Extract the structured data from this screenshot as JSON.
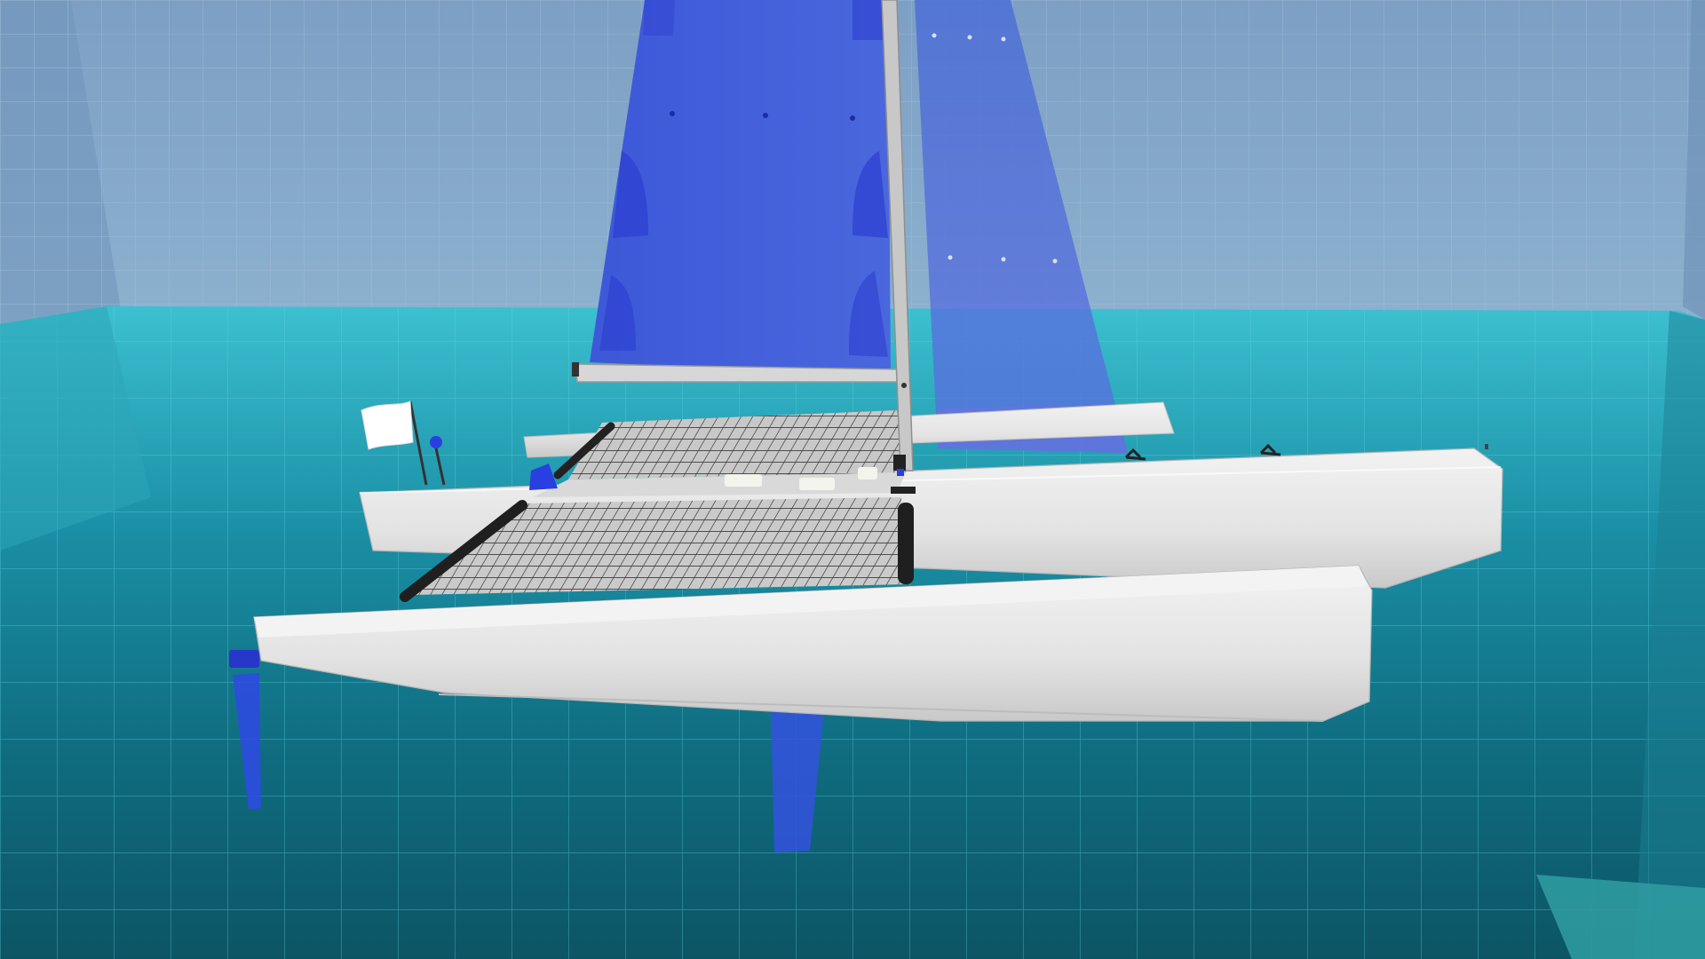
{
  "scene": {
    "kind": "3d-viewport",
    "subject": "catamaran-sailboat",
    "colors": {
      "room_wall": "#7a9ec2",
      "water_near": "#0d5a6a",
      "water_far": "#37b9cb",
      "hull": "#e7e7e7",
      "sail": "#3f5ae0",
      "foil": "#2b45e6",
      "flag": "#ffffff"
    },
    "objects": [
      {
        "name": "mainsail",
        "icon": "sail-icon"
      },
      {
        "name": "jib",
        "icon": "sail-icon"
      },
      {
        "name": "mast"
      },
      {
        "name": "boom"
      },
      {
        "name": "port-hull"
      },
      {
        "name": "starboard-hull"
      },
      {
        "name": "trampoline-net"
      },
      {
        "name": "flag",
        "icon": "flag-icon"
      },
      {
        "name": "rudder"
      },
      {
        "name": "daggerboard"
      }
    ]
  }
}
